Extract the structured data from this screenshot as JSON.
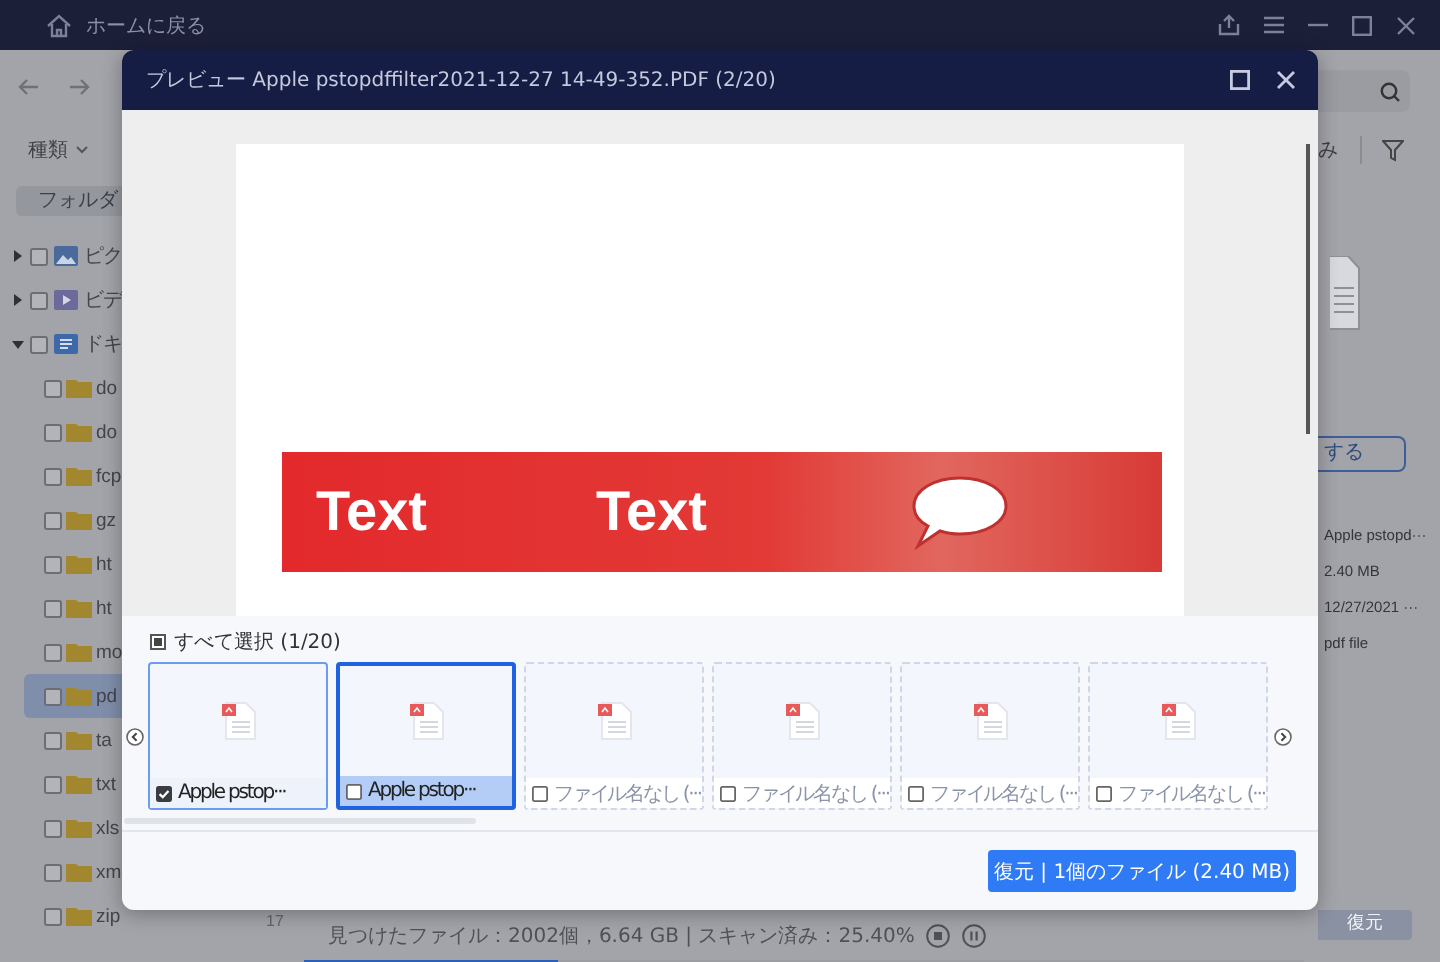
{
  "top_bar": {
    "home_label": "ホームに戻る"
  },
  "toolbar": {
    "type_filter": "種類"
  },
  "sidebar": {
    "tab": "フォルダ",
    "tree": [
      {
        "label": "ピク",
        "kind": "pictures",
        "expanded": false,
        "checked": false
      },
      {
        "label": "ビデ",
        "kind": "videos",
        "expanded": false,
        "checked": false
      },
      {
        "label": "ドキ",
        "kind": "documents",
        "expanded": true,
        "checked": false,
        "children": [
          {
            "label": "do",
            "checked": false,
            "selected": false
          },
          {
            "label": "do",
            "checked": false,
            "selected": false
          },
          {
            "label": "fcp",
            "checked": false,
            "selected": false
          },
          {
            "label": "gz",
            "checked": false,
            "selected": false
          },
          {
            "label": "ht",
            "checked": false,
            "selected": false
          },
          {
            "label": "ht",
            "checked": false,
            "selected": false
          },
          {
            "label": "mo",
            "checked": false,
            "selected": false
          },
          {
            "label": "pd",
            "checked": false,
            "selected": true
          },
          {
            "label": "ta",
            "checked": false,
            "selected": false
          },
          {
            "label": "txt",
            "checked": false,
            "selected": false
          },
          {
            "label": "xls",
            "checked": false,
            "selected": false
          },
          {
            "label": "xm",
            "checked": false,
            "selected": false
          },
          {
            "label": "zip",
            "checked": false,
            "selected": false
          }
        ]
      }
    ]
  },
  "details": {
    "more_label": "み",
    "action_button": "する",
    "name": "Apple pstopd···",
    "size": "2.40 MB",
    "date": "12/27/2021 ···",
    "type": "pdf file",
    "recover_button": {
      "label": "復元",
      "disabled": true
    }
  },
  "status": {
    "count": "17",
    "summary": "見つけたファイル：2002個，6.64 GB | スキャン済み：25.40%",
    "level": 0.254
  },
  "preview": {
    "title": "プレビュー Apple pstopdffilter2021-12-27 14-49-352.PDF (2/20)",
    "page_texts": [
      "Text",
      "Text"
    ],
    "select_all": {
      "label": "すべて選択 (1/20)",
      "indeterminate": true
    },
    "thumbnails": [
      {
        "label": "Apple pstop···",
        "checked": true,
        "selected": false,
        "disabled": false
      },
      {
        "label": "Apple pstop···",
        "checked": false,
        "selected": true,
        "disabled": false
      },
      {
        "label": "ファイル名なし (···",
        "checked": false,
        "selected": false,
        "disabled": true
      },
      {
        "label": "ファイル名なし (···",
        "checked": false,
        "selected": false,
        "disabled": true
      },
      {
        "label": "ファイル名なし (···",
        "checked": false,
        "selected": false,
        "disabled": true
      },
      {
        "label": "ファイル名なし (···",
        "checked": false,
        "selected": false,
        "disabled": true
      }
    ],
    "recover_button": "復元 | 1個のファイル (2.40 MB)"
  }
}
